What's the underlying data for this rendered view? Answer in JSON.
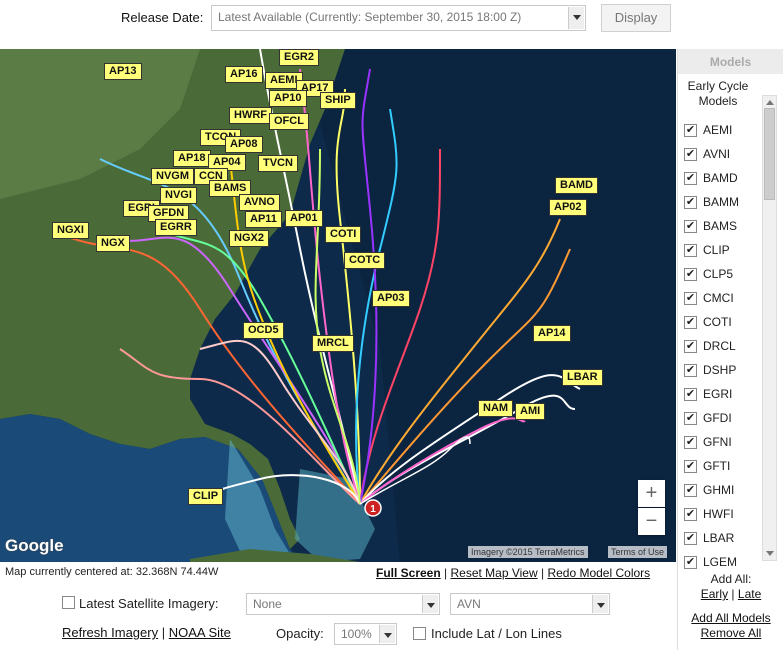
{
  "header": {
    "release_label": "Release Date:",
    "release_value": "Latest Available (Currently: September 30, 2015 18:00 Z)",
    "display_button": "Display"
  },
  "map": {
    "center_text": "Map currently centered at: 32.368N 74.44W",
    "full_screen": "Full Screen",
    "reset_view": "Reset Map View",
    "redo_colors": "Redo Model Colors",
    "google_logo": "Google",
    "imagery_credit": "Imagery ©2015 TerraMetrics",
    "terms": "Terms of Use",
    "storm_marker": "1",
    "zoom_in": "+",
    "zoom_out": "−",
    "labels": [
      "AP13",
      "EGR2",
      "AP16",
      "AEMI",
      "AP17",
      "AP10",
      "SHIP",
      "HWRF",
      "OFCL",
      "TCON",
      "AP08",
      "AP18",
      "AP04",
      "TVCN",
      "NVGM",
      "CCN",
      "BAMS",
      "NVGI",
      "AVNO",
      "EGRI",
      "GFDN",
      "AP11",
      "AP01",
      "EGRR",
      "NGXI",
      "NGX",
      "NGX2",
      "COTI",
      "COTC",
      "AP03",
      "BAMD",
      "AP02",
      "OCD5",
      "MRCL",
      "AP14",
      "LBAR",
      "NAM",
      "AMI",
      "CLIP"
    ]
  },
  "sidebar": {
    "title": "Models",
    "subtitle": "Early Cycle Models",
    "models": [
      "AEMI",
      "AVNI",
      "BAMD",
      "BAMM",
      "BAMS",
      "CLIP",
      "CLP5",
      "CMCI",
      "COTI",
      "DRCL",
      "DSHP",
      "EGRI",
      "GFDI",
      "GFNI",
      "GFTI",
      "GHMI",
      "HWFI",
      "LBAR",
      "LGEM"
    ],
    "add_all": "Add All:",
    "early": "Early",
    "sep": "|",
    "late": "Late",
    "add_all_models": "Add All Models",
    "remove_all": "Remove All"
  },
  "bottom": {
    "latest_sat": "Latest Satellite Imagery:",
    "sat_none": "None",
    "sat_avn": "AVN",
    "refresh": "Refresh Imagery",
    "noaa": "NOAA Site",
    "sep": "|",
    "opacity_label": "Opacity:",
    "opacity_value": "100%",
    "latlon": "Include Lat / Lon Lines"
  },
  "colors": {
    "label_bg": "#ffff7a",
    "ocean": "#0e2a4a",
    "land": "#4a6b38",
    "storm_marker": "#cc2222"
  }
}
